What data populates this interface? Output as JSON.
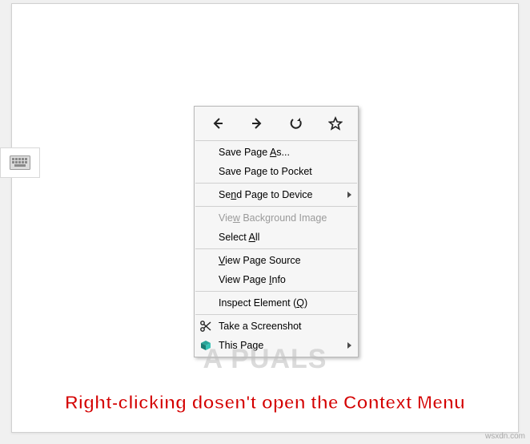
{
  "context_menu": {
    "save_page_as": "Save Page As...",
    "save_page_pocket": "Save Page to Pocket",
    "send_page_device": "Send Page to Device",
    "view_bg_image": "View Background Image",
    "select_all": "Select All",
    "view_source": "View Page Source",
    "view_info": "View Page Info",
    "inspect": "Inspect Element (Q)",
    "screenshot": "Take a Screenshot",
    "this_page": "This Page"
  },
  "watermark": "A   PUALS",
  "caption": "Right-clicking dosen't open the Context Menu",
  "domain_mark": "wsxdn.com"
}
